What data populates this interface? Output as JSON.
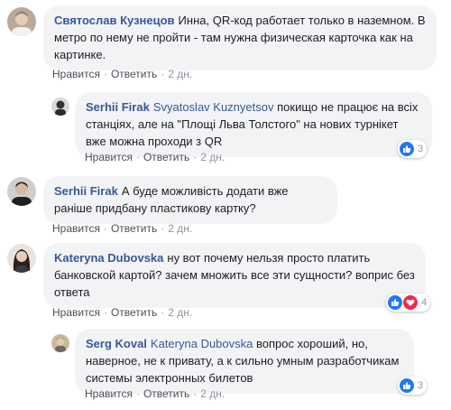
{
  "comments": [
    {
      "name": "Святослав Кузнецов",
      "text": "Инна, QR-код работает только в наземном. В метро по нему не пройти - там нужна физическая карточка как на картинке.",
      "like": "Нравится",
      "reply": "Ответить",
      "time": "2 дн."
    },
    {
      "name": "Serhii Firak",
      "mention": "Svyatoslav Kuznyetsov",
      "text": "покищо не працює на всіх станціях, але на \"Площі Льва Толстого\" на нових турнікет вже можна проходи з QR",
      "like": "Нравится",
      "reply": "Ответить",
      "time": "2 дн.",
      "reactions": "3"
    },
    {
      "name": "Serhii Firak",
      "text": "А буде можливість додати вже раніше придбану пластикову картку?",
      "like": "Нравится",
      "reply": "Ответить",
      "time": "2 дн."
    },
    {
      "name": "Kateryna Dubovska",
      "text": "ну вот почему нельзя просто платить банковской картой? зачем множить все эти сущности? воприс без ответа",
      "like": "Нравится",
      "reply": "Ответить",
      "time": "2 дн.",
      "reactions": "4"
    },
    {
      "name": "Serg Koval",
      "mention": "Kateryna Dubovska",
      "text": "вопрос хороший, но, наверное, не к привату, а к сильно умным разработчикам системы электронных билетов",
      "like": "Нравится",
      "reply": "Ответить",
      "time": "2 дн.",
      "reactions": "3"
    }
  ],
  "colors": {
    "name": "#385898",
    "bubble": "#f2f3f5",
    "like_blue": "#2078f4",
    "love_red": "#f0284a",
    "meta": "#90949c"
  },
  "icons": [
    "like-icon",
    "love-icon"
  ]
}
